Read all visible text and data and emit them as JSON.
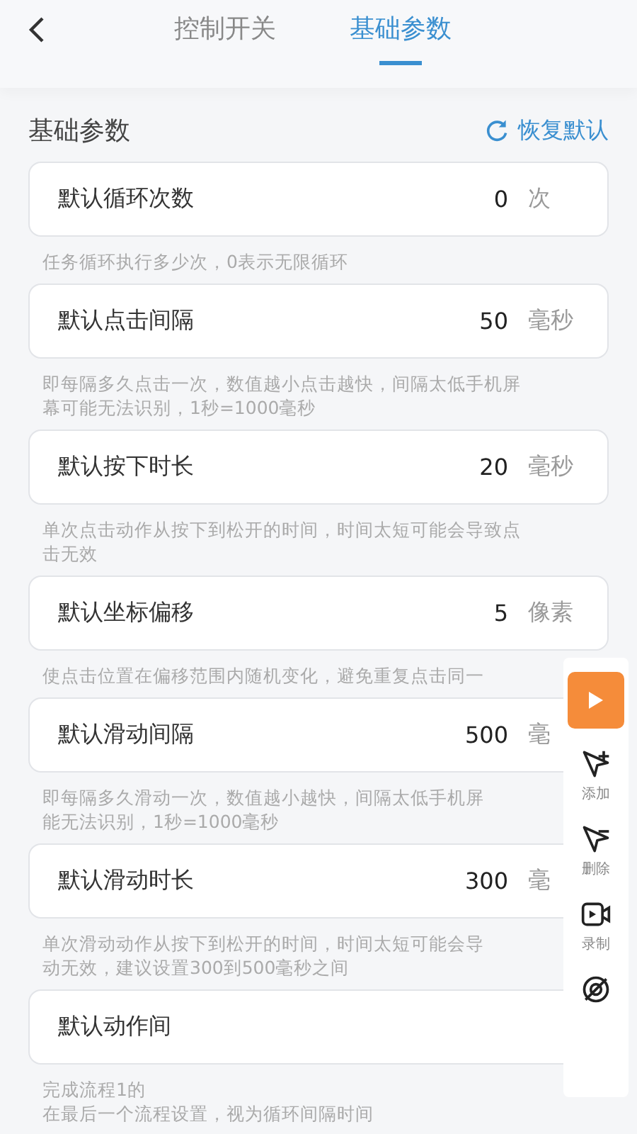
{
  "tabs": [
    {
      "label": "控制开关",
      "selected": false
    },
    {
      "label": "基础参数",
      "selected": true
    }
  ],
  "section": {
    "title": "基础参数",
    "reset": "恢复默认"
  },
  "params": [
    {
      "label": "默认循环次数",
      "value": "0",
      "unit": "次",
      "hint": [
        "任务循环执行多少次，0表示无限循环"
      ]
    },
    {
      "label": "默认点击间隔",
      "value": "50",
      "unit": "毫秒",
      "hint": [
        "即每隔多久点击一次，数值越小点击越快，间隔太低手机屏",
        "幕可能无法识别，1秒=1000毫秒"
      ]
    },
    {
      "label": "默认按下时长",
      "value": "20",
      "unit": "毫秒",
      "hint": [
        "单次点击动作从按下到松开的时间，时间太短可能会导致点",
        "击无效"
      ]
    },
    {
      "label": "默认坐标偏移",
      "value": "5",
      "unit": "像素",
      "hint": [
        "使点击位置在偏移范围内随机变化，避免重复点击同一"
      ]
    },
    {
      "label": "默认滑动间隔",
      "value": "500",
      "unit": "毫",
      "hint": [
        "即每隔多久滑动一次，数值越小越快，间隔太低手机屏",
        "能无法识别，1秒=1000毫秒"
      ]
    },
    {
      "label": "默认滑动时长",
      "value": "300",
      "unit": "毫",
      "hint": [
        "单次滑动动作从按下到松开的时间，时间太短可能会导",
        "动无效，建议设置300到500毫秒之间"
      ]
    },
    {
      "label": "默认动作间",
      "hint": [
        "完成流程1的",
        "在最后一个流程设置，视为循环间隔时间"
      ]
    }
  ],
  "toolbar": [
    {
      "kind": "add",
      "label": "添加"
    },
    {
      "kind": "delete",
      "label": "删除"
    },
    {
      "kind": "record",
      "label": "录制"
    },
    {
      "kind": "hide"
    }
  ]
}
